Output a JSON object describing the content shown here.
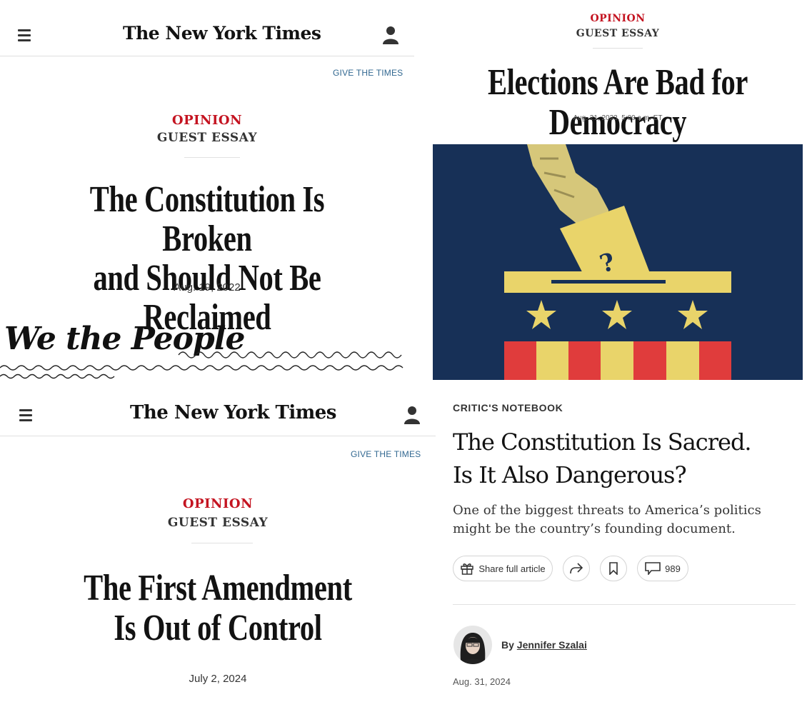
{
  "panel1": {
    "masthead": "The New York Times",
    "give": "GIVE THE TIMES",
    "kicker": "OPINION",
    "section": "GUEST ESSAY",
    "headline_line1": "The Constitution Is Broken",
    "headline_line2": "and Should Not Be Reclaimed",
    "date": "Aug. 19, 2022",
    "image_text": "We the People"
  },
  "panel2": {
    "kicker": "OPINION",
    "section": "GUEST ESSAY",
    "headline": "Elections Are Bad for Democracy",
    "date": "Aug. 21, 2023, 5:00 a.m. ET",
    "colors": {
      "navy": "#173057",
      "yellow": "#e9d46a",
      "red": "#e03c3c"
    }
  },
  "panel3": {
    "masthead": "The New York Times",
    "give": "GIVE THE TIMES",
    "kicker": "OPINION",
    "section": "GUEST ESSAY",
    "headline_line1": "The First Amendment",
    "headline_line2": "Is Out of Control",
    "date": "July 2, 2024"
  },
  "panel4": {
    "kicker": "CRITIC'S NOTEBOOK",
    "headline_line1": "The Constitution Is Sacred.",
    "headline_line2": "Is It Also Dangerous?",
    "dek": "One of the biggest threats to America’s politics might be the country’s founding document.",
    "share_label": "Share full article",
    "comment_count": "989",
    "byline_prefix": "By",
    "author": "Jennifer Szalai",
    "date": "Aug. 31, 2024"
  }
}
